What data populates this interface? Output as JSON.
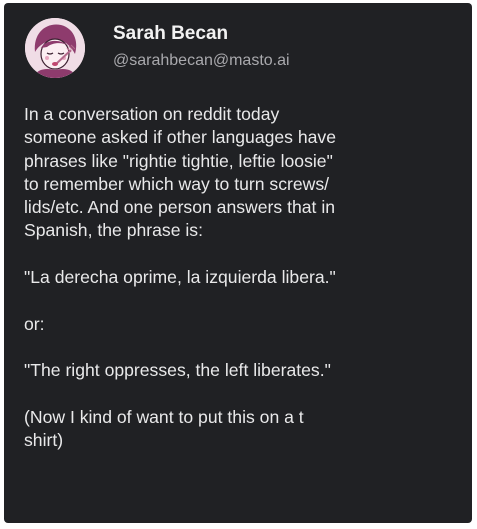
{
  "post": {
    "author": {
      "display_name": "Sarah Becan",
      "handle": "@sarahbecan@masto.ai",
      "avatar_icon": "illustrated-avatar-icon"
    },
    "paragraphs": [
      "In a conversation on reddit today\nsomeone asked if other languages have\nphrases like \"rightie tightie, leftie loosie\"\nto remember which way to turn screws/\nlids/etc. And one person answers that in\nSpanish, the phrase is:",
      "\"La derecha oprime, la izquierda libera.\"",
      "or:",
      "\"The right oppresses, the left liberates.\"",
      "(Now I kind of want to put this on a t\nshirt)"
    ]
  },
  "colors": {
    "background": "#202124",
    "name_text": "#f2f2f2",
    "handle_text": "#a9a9ad",
    "body_text": "#e9e9ea",
    "avatar_bg": "#f0dde6",
    "avatar_accent": "#8e3b6d"
  }
}
